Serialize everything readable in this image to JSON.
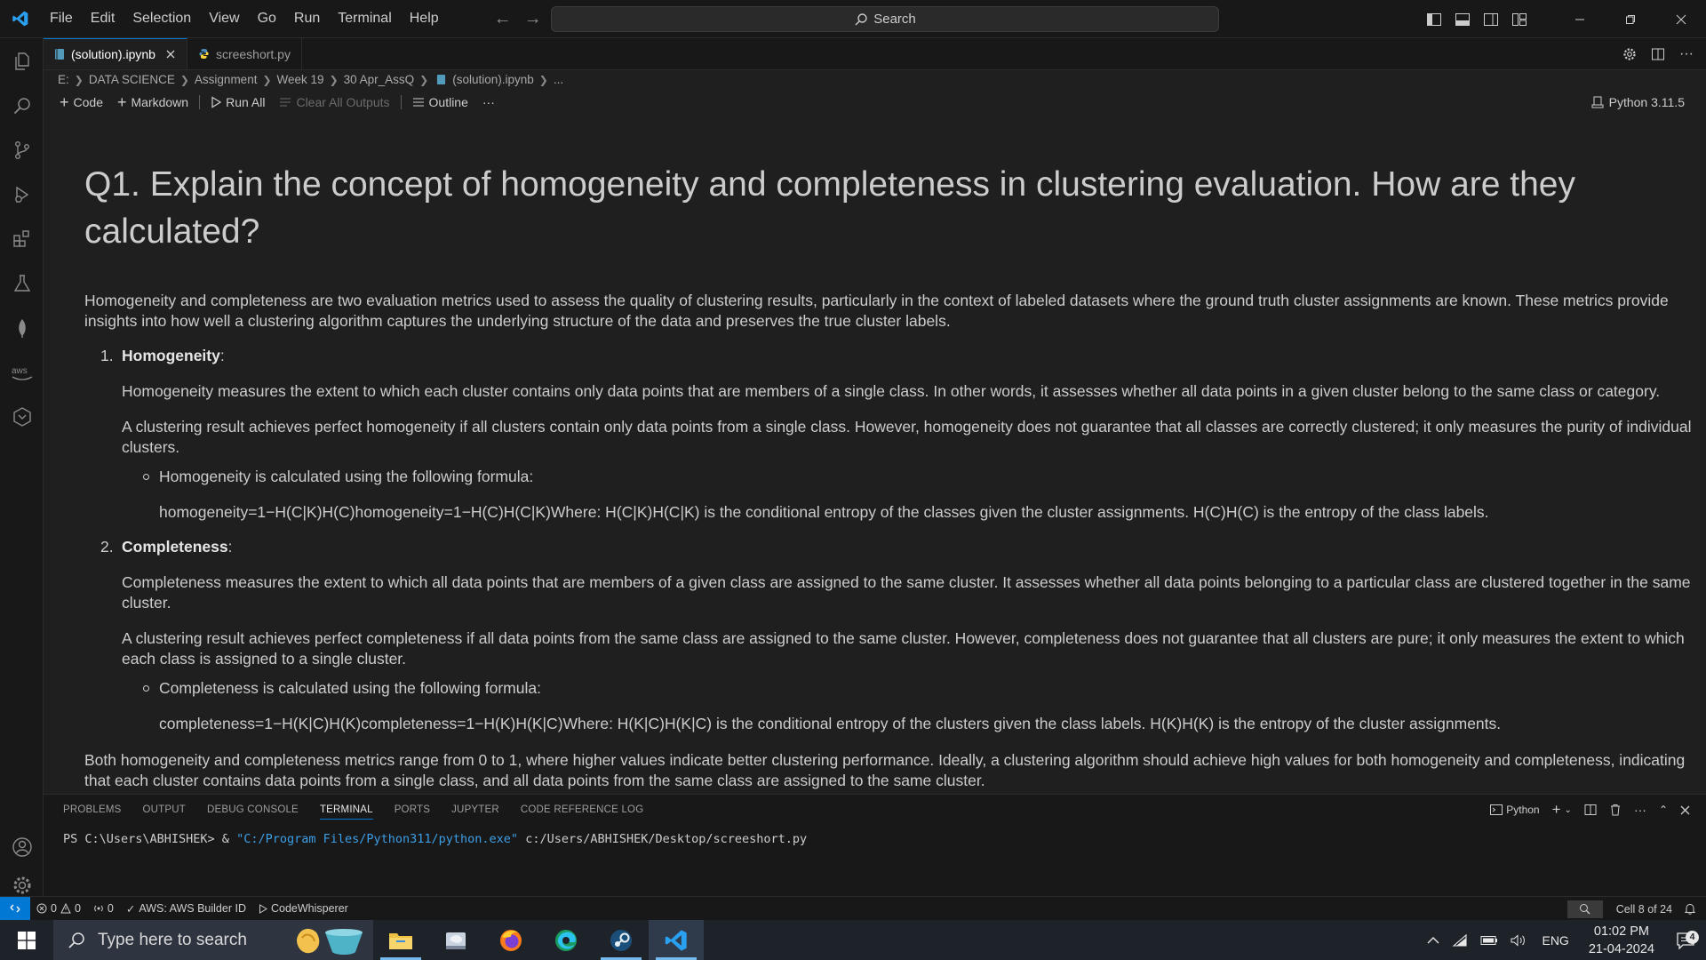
{
  "menu": [
    "File",
    "Edit",
    "Selection",
    "View",
    "Go",
    "Run",
    "Terminal",
    "Help"
  ],
  "search": {
    "label": "Search"
  },
  "tabs": [
    {
      "label": "(solution).ipynb",
      "active": true
    },
    {
      "label": "screeshort.py",
      "active": false
    }
  ],
  "breadcrumb": [
    "E:",
    "DATA SCIENCE",
    "Assignment",
    "Week 19",
    "30 Apr_AssQ",
    "(solution).ipynb",
    "..."
  ],
  "toolbar": {
    "code": "Code",
    "markdown": "Markdown",
    "run_all": "Run All",
    "clear_outputs": "Clear All Outputs",
    "outline": "Outline",
    "more": "···",
    "kernel": "Python 3.11.5"
  },
  "content": {
    "title": "Q1. Explain the concept of homogeneity and completeness in clustering evaluation. How are they calculated?",
    "intro": "Homogeneity and completeness are two evaluation metrics used to assess the quality of clustering results, particularly in the context of labeled datasets where the ground truth cluster assignments are known. These metrics provide insights into how well a clustering algorithm captures the underlying structure of the data and preserves the true cluster labels.",
    "items": [
      {
        "num": "1.",
        "heading": "Homogeneity",
        "p1": "Homogeneity measures the extent to which each cluster contains only data points that are members of a single class. In other words, it assesses whether all data points in a given cluster belong to the same class or category.",
        "p2": "A clustering result achieves perfect homogeneity if all clusters contain only data points from a single class. However, homogeneity does not guarantee that all classes are correctly clustered; it only measures the purity of individual clusters.",
        "bullet": "Homogeneity is calculated using the following formula:",
        "formula": "homogeneity=1−H(C|K)H(C)homogeneity=1−H(C)H(C|K)Where: H(C|K)H(C|K) is the conditional entropy of the classes given the cluster assignments. H(C)H(C) is the entropy of the class labels."
      },
      {
        "num": "2.",
        "heading": "Completeness",
        "p1": "Completeness measures the extent to which all data points that are members of a given class are assigned to the same cluster. It assesses whether all data points belonging to a particular class are clustered together in the same cluster.",
        "p2": "A clustering result achieves perfect completeness if all data points from the same class are assigned to the same cluster. However, completeness does not guarantee that all clusters are pure; it only measures the extent to which each class is assigned to a single cluster.",
        "bullet": "Completeness is calculated using the following formula:",
        "formula": "completeness=1−H(K|C)H(K)completeness=1−H(K)H(K|C)Where: H(K|C)H(K|C) is the conditional entropy of the clusters given the class labels. H(K)H(K) is the entropy of the cluster assignments."
      }
    ],
    "conclusion": "Both homogeneity and completeness metrics range from 0 to 1, where higher values indicate better clustering performance. Ideally, a clustering algorithm should achieve high values for both homogeneity and completeness, indicating that each cluster contains data points from a single class, and all data points from the same class are assigned to the same cluster."
  },
  "panel": {
    "tabs": [
      "PROBLEMS",
      "OUTPUT",
      "DEBUG CONSOLE",
      "TERMINAL",
      "PORTS",
      "JUPYTER",
      "CODE REFERENCE LOG"
    ],
    "active_tab": "TERMINAL",
    "shell": "Python",
    "terminal": {
      "prompt": "PS C:\\Users\\ABHISHEK> & ",
      "exe": "\"C:/Program Files/Python311/python.exe\"",
      "arg": " c:/Users/ABHISHEK/Desktop/screeshort.py"
    }
  },
  "status": {
    "errors": "0",
    "warnings": "0",
    "ports": "0",
    "aws": "AWS: AWS Builder ID",
    "codewhisperer": "CodeWhisperer",
    "cell": "Cell 8 of 24"
  },
  "taskbar": {
    "search_placeholder": "Type here to search",
    "lang": "ENG",
    "time": "01:02 PM",
    "date": "21-04-2024",
    "notifications": "4"
  },
  "colors": {
    "accent": "#0078d4",
    "background": "#1f1f1f",
    "chrome": "#181818",
    "terminal_string": "#3c9ee6"
  }
}
